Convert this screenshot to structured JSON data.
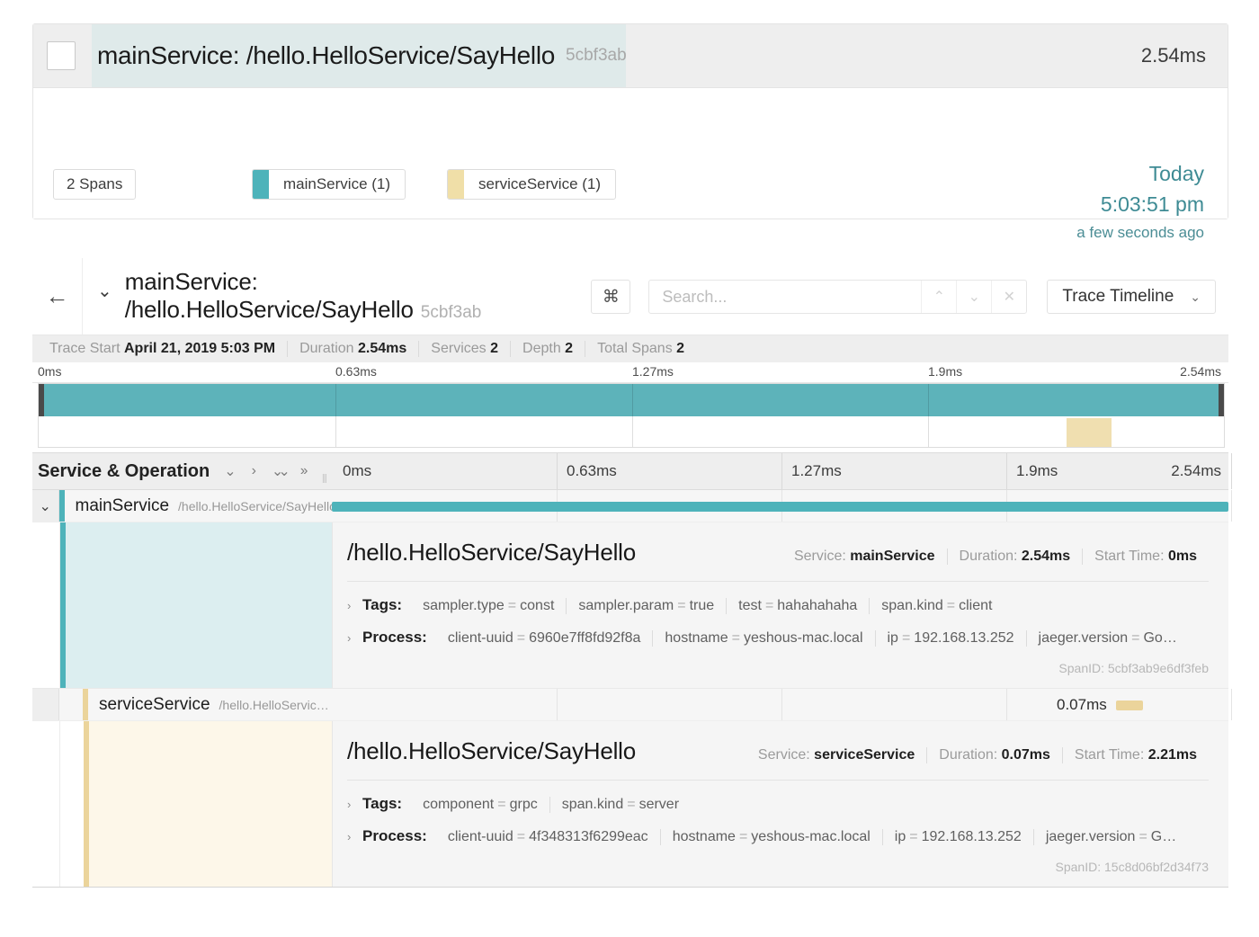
{
  "search_result": {
    "checkbox_checked": false,
    "title": "mainService: /hello.HelloService/SayHello",
    "trace_id_short": "5cbf3ab",
    "duration": "2.54ms",
    "span_count_label": "2 Spans",
    "services": [
      {
        "name": "mainService (1)",
        "color": "#4eb3ba"
      },
      {
        "name": "serviceService (1)",
        "color": "#f0dfa8"
      }
    ],
    "when": {
      "day": "Today",
      "time": "5:03:51 pm",
      "relative": "a few seconds ago"
    }
  },
  "trace": {
    "back_icon": "←",
    "collapse_icon": "⌄",
    "title": "mainService: /hello.HelloService/SayHello",
    "trace_id_short": "5cbf3ab",
    "toolbar": {
      "cmd_icon": "⌘",
      "search_placeholder": "Search...",
      "search_value": "",
      "prev_icon": "⌃",
      "next_icon": "⌄",
      "clear_icon": "✕",
      "view_label": "Trace Timeline",
      "view_chevron": "⌄"
    },
    "stats": [
      {
        "label": "Trace Start",
        "value": "April 21, 2019 5:03 PM"
      },
      {
        "label": "Duration",
        "value": "2.54ms"
      },
      {
        "label": "Services",
        "value": "2"
      },
      {
        "label": "Depth",
        "value": "2"
      },
      {
        "label": "Total Spans",
        "value": "2"
      }
    ],
    "ticks": [
      "0ms",
      "0.63ms",
      "1.27ms",
      "1.9ms",
      "2.54ms"
    ],
    "column_header": {
      "title": "Service & Operation",
      "icons": [
        "chevron-down",
        "chevron-right",
        "double-chevron-down",
        "double-chevron-right"
      ],
      "icon_glyphs": [
        "⌄",
        "›",
        "⌄⌄",
        "››"
      ]
    },
    "spans": [
      {
        "toggle_icon": "⌄",
        "service": "mainService",
        "operation_short": "/hello.HelloService/SayHello",
        "color": "#4eb3ba",
        "tint": "#dceef0",
        "depth": 0,
        "bar_start_pct": 0,
        "bar_width_pct": 100,
        "bar_label": "",
        "detail": {
          "operation": "/hello.HelloService/SayHello",
          "meta": [
            {
              "label": "Service:",
              "value": "mainService"
            },
            {
              "label": "Duration:",
              "value": "2.54ms"
            },
            {
              "label": "Start Time:",
              "value": "0ms"
            }
          ],
          "tags_label": "Tags:",
          "tags": [
            {
              "key": "sampler.type",
              "value": "const"
            },
            {
              "key": "sampler.param",
              "value": "true"
            },
            {
              "key": "test",
              "value": "hahahahaha"
            },
            {
              "key": "span.kind",
              "value": "client"
            }
          ],
          "process_label": "Process:",
          "process": [
            {
              "key": "client-uuid",
              "value": "6960e7ff8fd92f8a"
            },
            {
              "key": "hostname",
              "value": "yeshous-mac.local"
            },
            {
              "key": "ip",
              "value": "192.168.13.252"
            },
            {
              "key": "jaeger.version",
              "value": "Go…"
            }
          ],
          "span_id": "SpanID: 5cbf3ab9e6df3feb"
        }
      },
      {
        "toggle_icon": "",
        "service": "serviceService",
        "operation_short": "/hello.HelloServic…",
        "color": "#ebd49b",
        "tint": "#fdf7e9",
        "depth": 1,
        "bar_start_pct": 87.0,
        "bar_width_pct": 2.8,
        "bar_label": "0.07ms",
        "detail": {
          "operation": "/hello.HelloService/SayHello",
          "meta": [
            {
              "label": "Service:",
              "value": "serviceService"
            },
            {
              "label": "Duration:",
              "value": "0.07ms"
            },
            {
              "label": "Start Time:",
              "value": "2.21ms"
            }
          ],
          "tags_label": "Tags:",
          "tags": [
            {
              "key": "component",
              "value": "grpc"
            },
            {
              "key": "span.kind",
              "value": "server"
            }
          ],
          "process_label": "Process:",
          "process": [
            {
              "key": "client-uuid",
              "value": "4f348313f6299eac"
            },
            {
              "key": "hostname",
              "value": "yeshous-mac.local"
            },
            {
              "key": "ip",
              "value": "192.168.13.252"
            },
            {
              "key": "jaeger.version",
              "value": "G…"
            }
          ],
          "span_id": "SpanID: 15c8d06bf2d34f73"
        }
      }
    ]
  }
}
